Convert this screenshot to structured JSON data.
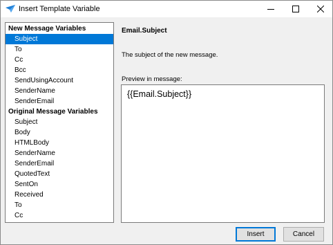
{
  "window": {
    "title": "Insert Template Variable",
    "app_icon": "envelope-icon"
  },
  "list": {
    "groups": [
      {
        "label": "New Message Variables",
        "items": [
          "Subject",
          "To",
          "Cc",
          "Bcc",
          "SendUsingAccount",
          "SenderName",
          "SenderEmail"
        ]
      },
      {
        "label": "Original Message Variables",
        "items": [
          "Subject",
          "Body",
          "HTMLBody",
          "SenderName",
          "SenderEmail",
          "QuotedText",
          "SentOn",
          "Received",
          "To",
          "Cc"
        ]
      }
    ],
    "selected": "New Message Variables / Subject"
  },
  "detail": {
    "title": "Email.Subject",
    "description": "The subject of the new message.",
    "preview_label": "Preview in message:",
    "preview_value": "{{Email.Subject}}"
  },
  "buttons": {
    "insert": "Insert",
    "cancel": "Cancel"
  },
  "colors": {
    "selection": "#0078d7",
    "default_button_border": "#0078d7"
  }
}
